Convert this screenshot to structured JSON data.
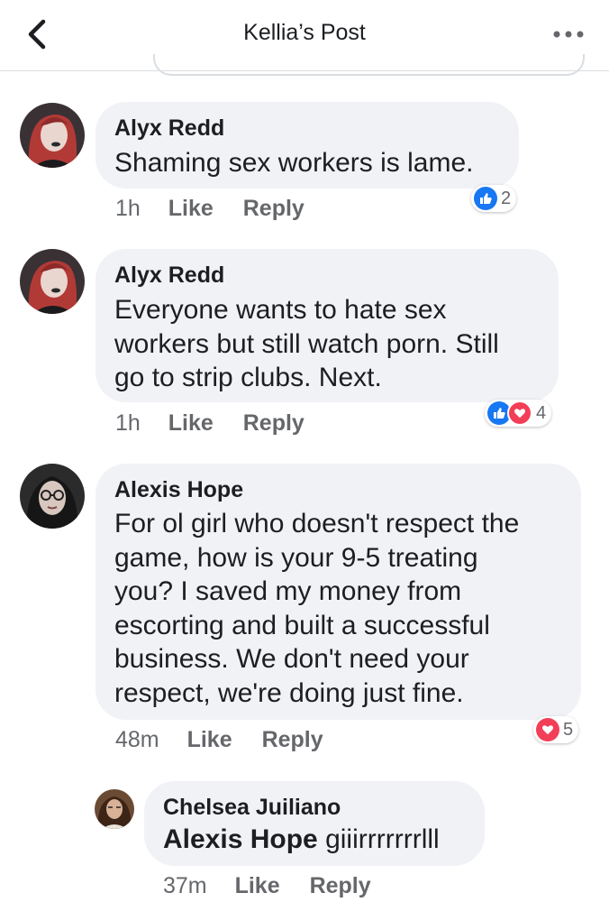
{
  "header": {
    "title": "Kellia’s Post"
  },
  "colors": {
    "like": "#1877f2",
    "love": "#f33e58",
    "bubble": "#f0f2f5",
    "meta": "#65676b"
  },
  "comments": [
    {
      "author": "Alyx Redd",
      "text": "Shaming sex workers is lame.",
      "time": "1h",
      "like_label": "Like",
      "reply_label": "Reply",
      "reactions": {
        "types": [
          "like"
        ],
        "count": "2"
      }
    },
    {
      "author": "Alyx Redd",
      "lines": [
        "Everyone wants to hate sex",
        "workers but still watch porn. Still",
        "go to strip clubs. Next."
      ],
      "time": "1h",
      "like_label": "Like",
      "reply_label": "Reply",
      "reactions": {
        "types": [
          "like",
          "love"
        ],
        "count": "4"
      }
    },
    {
      "author": "Alexis Hope",
      "lines": [
        "For ol girl who doesn't respect the",
        "game, how is your 9-5 treating",
        "you? I saved my money from",
        "escorting and built a successful",
        "business. We don't need your",
        "respect, we're doing just fine."
      ],
      "time": "48m",
      "like_label": "Like",
      "reply_label": "Reply",
      "reactions": {
        "types": [
          "love"
        ],
        "count": "5"
      }
    },
    {
      "author": "Chelsea Juiliano",
      "mention": "Alexis Hope",
      "text": "giiirrrrrrrlll",
      "time": "37m",
      "like_label": "Like",
      "reply_label": "Reply"
    }
  ]
}
